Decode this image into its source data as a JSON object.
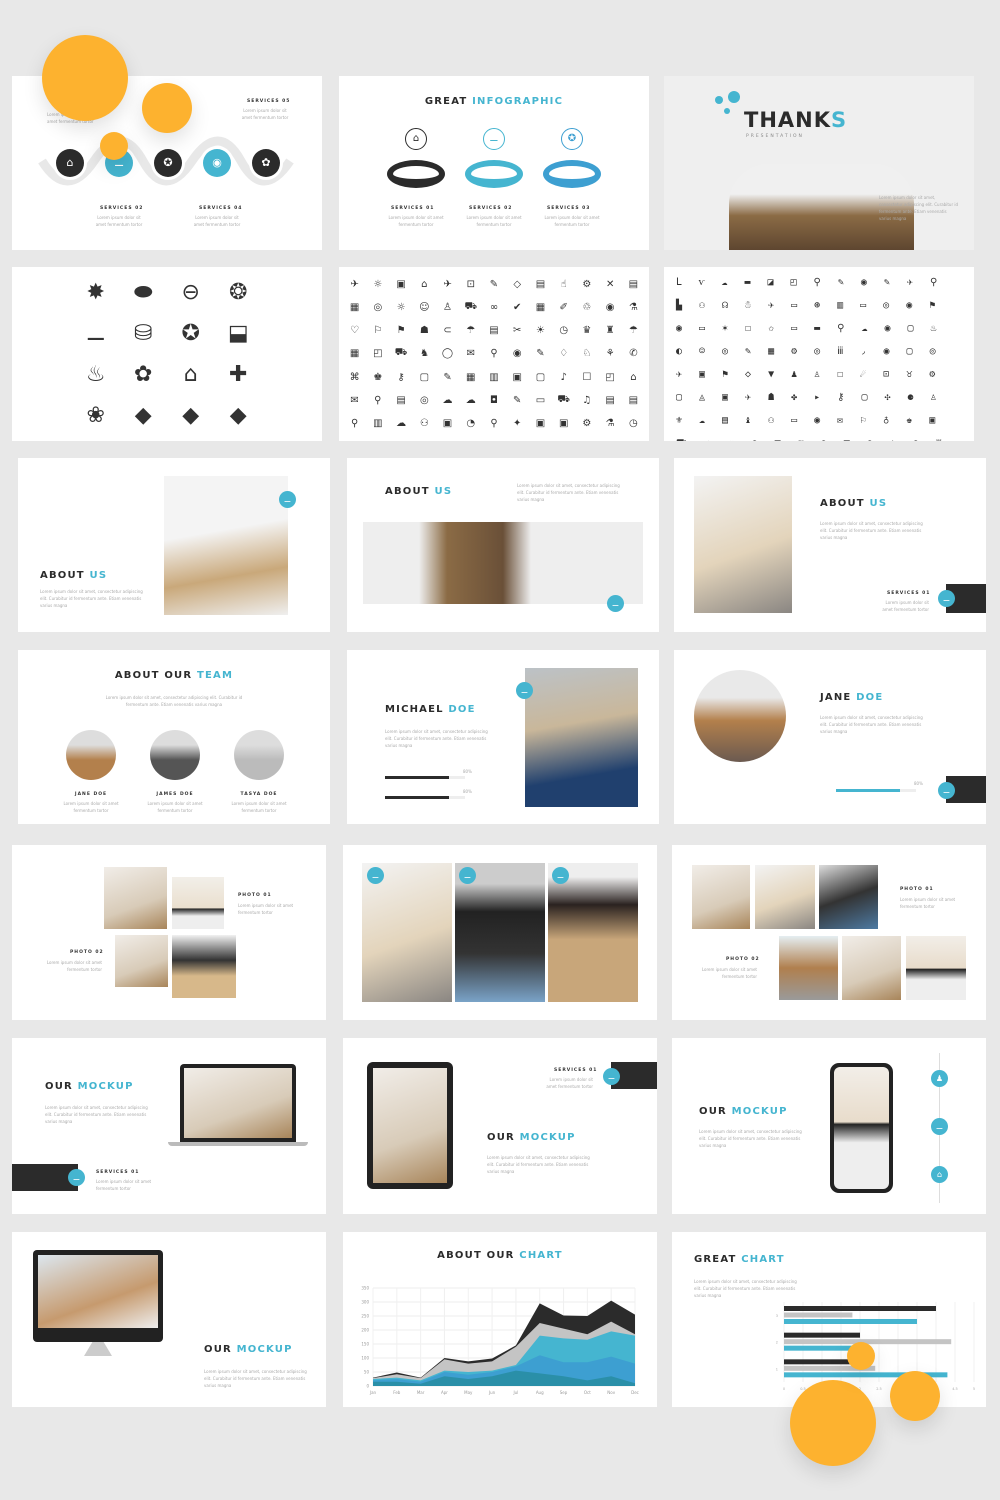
{
  "colors": {
    "accent": "#45b5d0",
    "dark": "#2b2b2b",
    "orange": "#fdb22f",
    "background": "#e8e8e8"
  },
  "lorem_short": "Lorem ipsum dolor sit amet fermentum tortor",
  "lorem": "Lorem ipsum dolor sit amet, consectetur adipiscing elit. Curabitur id fermentum ante. Etiam venenatis varius magna",
  "slide_services": {
    "items": [
      "SERVICES 02",
      "SERVICES 04",
      "SERVICES 05"
    ],
    "icons": [
      "doghouse-icon",
      "bone-icon",
      "award-icon",
      "pet-food-icon",
      "paw-icon"
    ]
  },
  "slide_infographic": {
    "title_a": "GREAT",
    "title_b": "INFOGRAPHIC",
    "items": [
      "SERVICES 01",
      "SERVICES 02",
      "SERVICES 03"
    ]
  },
  "slide_thanks": {
    "title_a": "THANK",
    "title_b": "S",
    "subtitle": "PRESENTATION"
  },
  "slide_pet_icons": {
    "icons": [
      "✸",
      "⬬",
      "⊖",
      "❂",
      "⚊",
      "⛁",
      "✪",
      "⬓",
      "♨",
      "✿",
      "⌂",
      "✚",
      "❀",
      "◆",
      "◆",
      "◆"
    ]
  },
  "slide_icons_a": {
    "icons": "✈☼▣⌂✈⊡✎◇▤☝⚙✕▤▦◎☼☺♙⛟∞✔▦✐♲◉⚗♡⚐⚑☗⊂☂▤✂☀◷♛♜☂▦◰⛟♞◯✉⚲◉✎♢♘⚘✆⌘♚⚷▢✎▦▥▣▢♪☐◰⌂✉⚲▤◎☁☁◘✎▭⛟♫▤▤⚲▥☁⚇▣◔⚲✦▣▣⚙⚗◷"
  },
  "slide_icons_b": {
    "icons": "ᒪѵ☁▬◪◰⚲✎◉✎✈⚲▙⚇☊☃✈▭⊛▥▭◎◉⚑◉▭✶☐✩▭▬⚲☁◉▢♨◐☺◎✎▦⚙◎ⅲ◞◉▢◎✈▣⚑◇▼♟♙☐☄⊡♉⚙▢◬▣✈☗✤▸⚷▢✣⚈♙⚜☁▤♝⚇▭◉✉⚐♁♚▣⛟☂⚒◎▣❦◉▦◕♙◎♖⛿◬♙▬♜⚲◍☗"
  },
  "slide_about1": {
    "title_a": "ABOUT",
    "title_b": "US"
  },
  "slide_about2": {
    "title_a": "ABOUT",
    "title_b": "US"
  },
  "slide_about3": {
    "title_a": "ABOUT",
    "title_b": "US",
    "service": "SERVICES 01"
  },
  "slide_team": {
    "title_a": "ABOUT OUR",
    "title_b": "TEAM",
    "members": [
      "JANE DOE",
      "JAMES DOE",
      "TASYA DOE"
    ]
  },
  "slide_michael": {
    "title_a": "MICHAEL",
    "title_b": "DOE",
    "skills": [
      {
        "label": "80%",
        "value": 80
      },
      {
        "label": "80%",
        "value": 80
      }
    ]
  },
  "slide_jane": {
    "title_a": "JANE",
    "title_b": "DOE",
    "skill": {
      "label": "80%",
      "value": 80
    }
  },
  "slide_photo1": {
    "labels": [
      "PHOTO 01",
      "PHOTO 02"
    ]
  },
  "slide_photo3": {
    "labels": [
      "PHOTO 01",
      "PHOTO 02"
    ]
  },
  "slide_mock1": {
    "title_a": "OUR",
    "title_b": "MOCKUP",
    "service": "SERVICES 01"
  },
  "slide_mock2": {
    "title_a": "OUR",
    "title_b": "MOCKUP",
    "service": "SERVICES 01"
  },
  "slide_mock3": {
    "title_a": "OUR",
    "title_b": "MOCKUP"
  },
  "slide_mock4": {
    "title_a": "OUR",
    "title_b": "MOCKUP"
  },
  "chart_data": [
    {
      "type": "area",
      "stacked": true,
      "title_a": "ABOUT OUR",
      "title_b": "CHART",
      "categories": [
        "Jan",
        "Feb",
        "Mar",
        "Apr",
        "May",
        "Jun",
        "Jul",
        "Aug",
        "Sep",
        "Oct",
        "Nov",
        "Dec"
      ],
      "ylim": [
        0,
        350
      ],
      "yticks": [
        0,
        50,
        100,
        150,
        200,
        250,
        300,
        350
      ],
      "grid": true,
      "series": [
        {
          "color": "#2a8fa8",
          "values": [
            15,
            15,
            8,
            35,
            25,
            35,
            55,
            45,
            35,
            20,
            35,
            10
          ]
        },
        {
          "color": "#3d9fd1",
          "values": [
            5,
            10,
            7,
            15,
            15,
            15,
            15,
            65,
            50,
            65,
            70,
            70
          ]
        },
        {
          "color": "#45b5d0",
          "values": [
            5,
            5,
            5,
            5,
            10,
            5,
            5,
            70,
            85,
            80,
            90,
            100
          ]
        },
        {
          "color": "#c4c4c4",
          "values": [
            3,
            12,
            8,
            40,
            30,
            33,
            65,
            45,
            35,
            20,
            35,
            5
          ]
        },
        {
          "color": "#2b2b2b",
          "values": [
            2,
            6,
            2,
            5,
            8,
            10,
            5,
            70,
            47,
            65,
            75,
            70
          ]
        }
      ]
    },
    {
      "type": "bar",
      "orientation": "horizontal",
      "title_a": "GREAT",
      "title_b": "CHART",
      "categories": [
        "1",
        "2",
        "3"
      ],
      "xlim": [
        0,
        5
      ],
      "xticks": [
        "0",
        "0.5",
        "1",
        "1.5",
        "2",
        "2.5",
        "3",
        "3.5",
        "4",
        "4.5",
        "5"
      ],
      "grid": true,
      "series": [
        {
          "color": "#2b2b2b",
          "values": [
            2,
            2,
            4
          ]
        },
        {
          "color": "#c4c4c4",
          "values": [
            2.4,
            4.4,
            1.8
          ]
        },
        {
          "color": "#45b5d0",
          "values": [
            4.3,
            1.8,
            3.5
          ]
        }
      ]
    }
  ]
}
